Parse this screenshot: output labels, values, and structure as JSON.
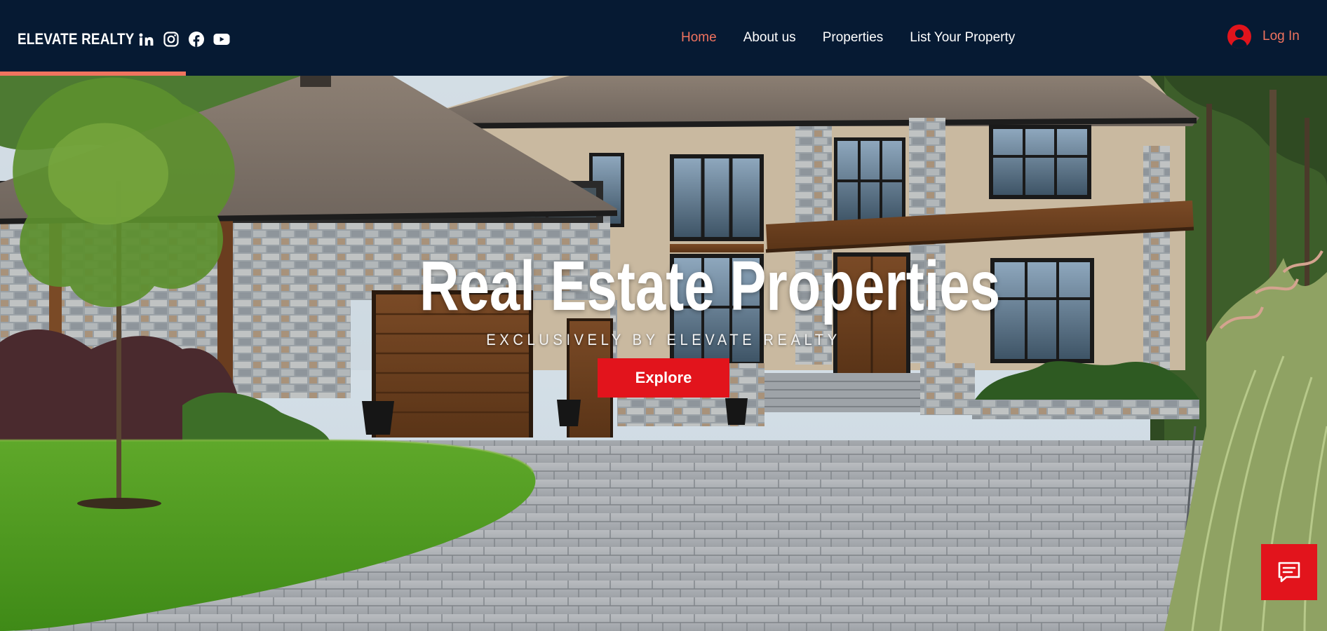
{
  "header": {
    "brand": "ELEVATE REALTY",
    "socials": [
      {
        "icon": "linkedin-icon"
      },
      {
        "icon": "instagram-icon"
      },
      {
        "icon": "facebook-icon"
      },
      {
        "icon": "youtube-icon"
      }
    ],
    "nav": [
      {
        "label": "Home",
        "active": true
      },
      {
        "label": "About us",
        "active": false
      },
      {
        "label": "Properties",
        "active": false
      },
      {
        "label": "List Your Property",
        "active": false
      }
    ],
    "login_label": "Log In"
  },
  "hero": {
    "title": "Real Estate Properties",
    "subtitle": "EXCLUSIVELY BY ELEVATE REALTY",
    "cta_label": "Explore",
    "image_alt": "Modern stone house with driveway"
  },
  "chat": {
    "icon": "chat-icon"
  },
  "colors": {
    "header_bg": "#061a33",
    "accent": "#f0735f",
    "brand_red": "#e2141c",
    "white": "#ffffff"
  }
}
